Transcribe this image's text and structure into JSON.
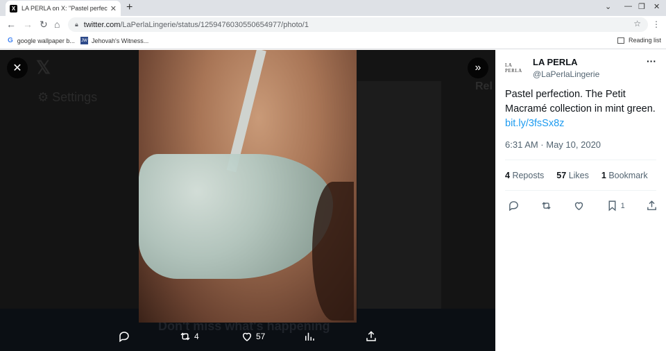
{
  "browser": {
    "tab_title": "LA PERLA on X: \"Pastel perfectio",
    "tab_favicon": "X",
    "url_host": "twitter.com",
    "url_path": "/LaPerlaLingerie/status/1259476030550654977/photo/1",
    "bookmarks": [
      {
        "icon": "G",
        "label": "google wallpaper b..."
      },
      {
        "icon": "JW",
        "label": "Jehovah's Witness..."
      }
    ],
    "reading_list": "Reading list"
  },
  "viewer": {
    "bg_settings_label": "Settings",
    "bg_rel_label": "Rel",
    "bg_bottom_text": "Don't miss what's happening",
    "reposts": "4",
    "likes": "57"
  },
  "tweet": {
    "avatar_text": "LA PERLA",
    "name": "LA PERLA",
    "handle": "@LaPerlaLingerie",
    "text": "Pastel perfection. The Petit Macramé collection in mint green.",
    "link": "bit.ly/3fsSx8z",
    "timestamp": "6:31 AM · May 10, 2020",
    "reposts_count": "4",
    "reposts_label": "Reposts",
    "likes_count": "57",
    "likes_label": "Likes",
    "bookmarks_count": "1",
    "bookmarks_label": "Bookmark",
    "bookmark_action_count": "1"
  }
}
